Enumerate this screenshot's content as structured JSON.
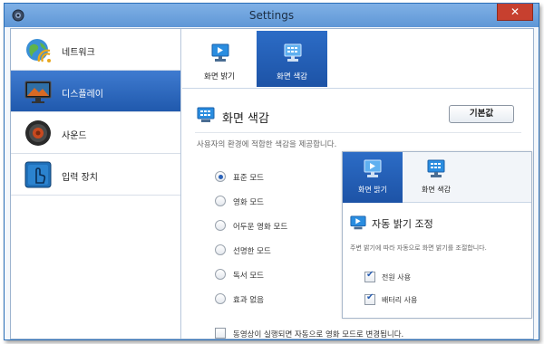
{
  "window": {
    "title": "Settings",
    "close_symbol": "✕",
    "accent": "#2a62b8"
  },
  "sidebar": {
    "items": [
      {
        "label": "네트워크",
        "icon": "globe-wifi-icon",
        "active": false
      },
      {
        "label": "디스플레이",
        "icon": "monitor-icon",
        "active": true
      },
      {
        "label": "사운드",
        "icon": "speaker-icon",
        "active": false
      },
      {
        "label": "입력 장치",
        "icon": "touch-hand-icon",
        "active": false
      }
    ]
  },
  "tabs": [
    {
      "label": "화면 밝기",
      "icon": "brightness-screen-icon",
      "active": false
    },
    {
      "label": "화면 색감",
      "icon": "color-screen-icon",
      "active": true
    }
  ],
  "section": {
    "title": "화면 색감",
    "description": "사용자의 환경에 적합한 색감을 제공합니다.",
    "default_button": "기본값"
  },
  "color_modes": [
    {
      "label": "표준 모드",
      "selected": true
    },
    {
      "label": "영화 모드",
      "selected": false
    },
    {
      "label": "어두운 영화 모드",
      "selected": false
    },
    {
      "label": "선명한 모드",
      "selected": false
    },
    {
      "label": "독서 모드",
      "selected": false
    },
    {
      "label": "효과 없음",
      "selected": false
    }
  ],
  "video_option": {
    "label": "동영상이 실행되면 자동으로 영화 모드로 변경됩니다.",
    "checked": false
  },
  "inset": {
    "tabs": [
      {
        "label": "화면 밝기",
        "active": true
      },
      {
        "label": "화면 색감",
        "active": false
      }
    ],
    "title": "자동 밝기 조정",
    "description": "주변 밝기에 따라 자동으로 화면 밝기를 조절합니다.",
    "checks": [
      {
        "label": "전원 사용",
        "checked": true
      },
      {
        "label": "배터리 사용",
        "checked": true
      }
    ]
  }
}
